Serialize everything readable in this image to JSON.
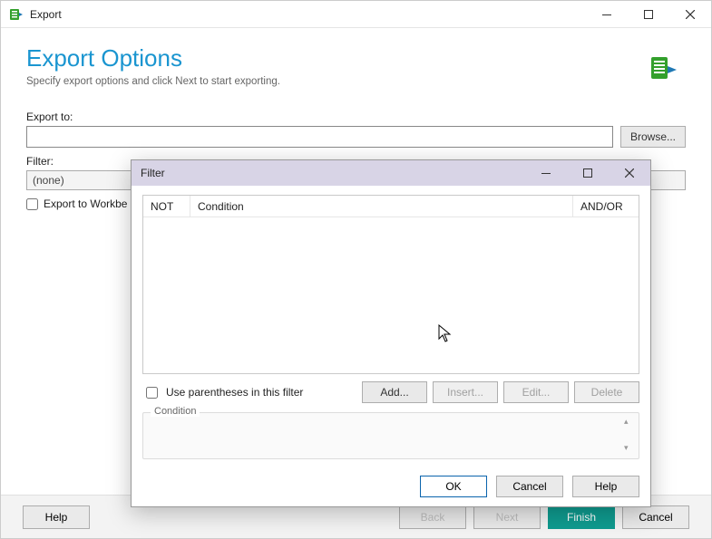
{
  "exportWindow": {
    "title": "Export",
    "header": {
      "heading": "Export Options",
      "subtitle": "Specify export options and click Next to start exporting."
    },
    "form": {
      "exportTo": {
        "label": "Export to:",
        "value": ""
      },
      "browseLabel": "Browse...",
      "filter": {
        "label": "Filter:",
        "value": "(none)"
      },
      "exportToWorkbench": {
        "label": "Export to Workbe",
        "checked": false
      }
    },
    "footer": {
      "help": "Help",
      "back": "Back",
      "next": "Next",
      "finish": "Finish",
      "cancel": "Cancel"
    }
  },
  "filterDialog": {
    "title": "Filter",
    "columns": {
      "not": "NOT",
      "condition": "Condition",
      "andor": "AND/OR"
    },
    "useParentheses": {
      "label": "Use parentheses in this filter",
      "checked": false
    },
    "buttons": {
      "add": "Add...",
      "insert": "Insert...",
      "edit": "Edit...",
      "delete": "Delete"
    },
    "conditionGroupLegend": "Condition",
    "footer": {
      "ok": "OK",
      "cancel": "Cancel",
      "help": "Help"
    }
  }
}
